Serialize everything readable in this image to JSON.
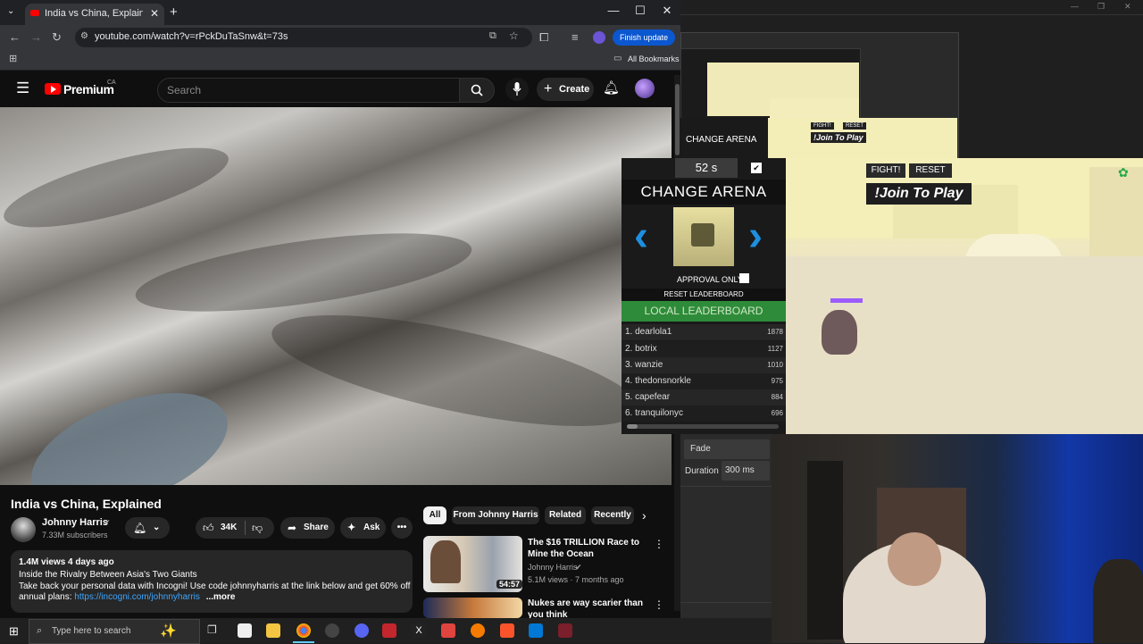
{
  "browser": {
    "tab_title": "India vs China, Explained - YouTube",
    "url": "youtube.com/watch?v=rPckDuTaSnw&t=73s",
    "finish_update": "Finish update",
    "all_bookmarks": "All Bookmarks"
  },
  "youtube": {
    "logo": "Premium",
    "region": "CA",
    "search_placeholder": "Search",
    "create_label": "Create",
    "video_title": "India vs China, Explained",
    "channel_name": "Johnny Harris",
    "subscribers": "7.33M subscribers",
    "like_count": "34K",
    "share_label": "Share",
    "ask_label": "Ask",
    "views_date": "1.4M views  4 days ago",
    "desc_line1": "Inside the Rivalry Between Asia's Two Giants",
    "desc_line2": "Take back your personal data with Incogni! Use code johnnyharris at the link below and get 60% off",
    "desc_line3_prefix": "annual plans: ",
    "desc_link": "https://incogni.com/johnnyharris",
    "desc_more": "...more",
    "chips": [
      "All",
      "From Johnny Harris",
      "Related",
      "Recently"
    ],
    "recs": [
      {
        "title": "The $16 TRILLION Race to Mine the Ocean",
        "channel": "Johnny Harris",
        "meta": "5.1M views · 7 months ago",
        "duration": "54:57"
      },
      {
        "title": "Nukes are way scarier than you think",
        "channel": "",
        "meta": "",
        "duration": ""
      }
    ]
  },
  "game": {
    "timer": "52 s",
    "change_arena": "CHANGE ARENA",
    "approval_only": "APPROVAL ONLY",
    "reset_leaderboard": "RESET LEADERBOARD",
    "local_leaderboard": "LOCAL LEADERBOARD",
    "fight_btn": "FIGHT!",
    "reset_btn": "RESET",
    "join_text": "!Join To Play",
    "leaderboard": [
      {
        "rank": "1.",
        "name": "dearlola1",
        "score": "1878"
      },
      {
        "rank": "2.",
        "name": "botrix",
        "score": "1127"
      },
      {
        "rank": "3.",
        "name": "wanzie",
        "score": "1010"
      },
      {
        "rank": "4.",
        "name": "thedonsnorkle",
        "score": "975"
      },
      {
        "rank": "5.",
        "name": "capefear",
        "score": "884"
      },
      {
        "rank": "6.",
        "name": "tranquilonyc",
        "score": "696"
      }
    ]
  },
  "obs": {
    "fade_label": "Fade",
    "duration_label": "Duration",
    "duration_value": "300 ms"
  },
  "taskbar": {
    "search_placeholder": "Type here to search"
  }
}
